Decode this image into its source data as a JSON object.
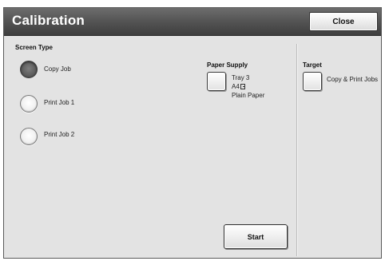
{
  "window": {
    "title": "Calibration",
    "close_label": "Close"
  },
  "screen_type": {
    "label": "Screen Type",
    "options": [
      {
        "label": "Copy Job",
        "selected": true
      },
      {
        "label": "Print Job 1",
        "selected": false
      },
      {
        "label": "Print Job 2",
        "selected": false
      }
    ]
  },
  "paper_supply": {
    "label": "Paper Supply",
    "tray": "Tray 3",
    "size": "A4",
    "size_icon": "paper-orientation-icon",
    "type": "Plain Paper"
  },
  "target": {
    "label": "Target",
    "value": "Copy & Print Jobs"
  },
  "actions": {
    "start_label": "Start"
  }
}
